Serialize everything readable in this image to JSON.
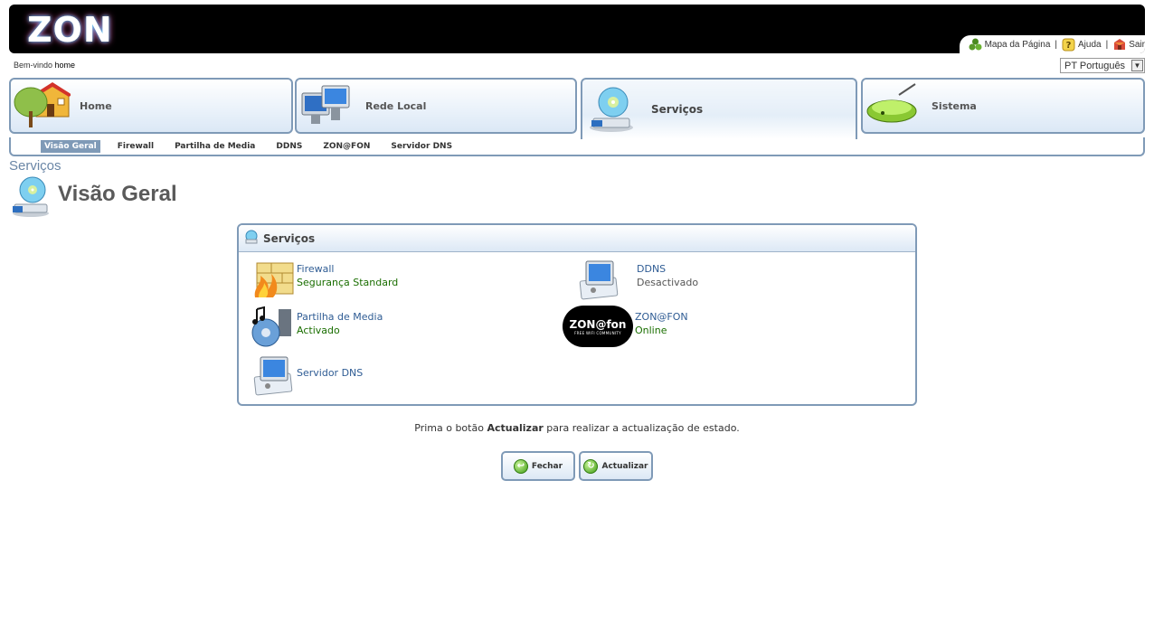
{
  "header": {
    "logo_text": "ZON",
    "links": [
      {
        "label": "Mapa da Página",
        "icon": "sitemap-icon"
      },
      {
        "label": "Ajuda",
        "icon": "help-icon"
      },
      {
        "label": "Sair",
        "icon": "exit-icon"
      }
    ],
    "separator": "|",
    "welcome_prefix": "Bem-vindo",
    "welcome_user": "home",
    "language": "PT Português"
  },
  "main_tabs": [
    {
      "label": "Home",
      "icon": "house-tree-icon"
    },
    {
      "label": "Rede Local",
      "icon": "computers-icon"
    },
    {
      "label": "Serviços",
      "icon": "disc-services-icon",
      "active": true
    },
    {
      "label": "Sistema",
      "icon": "router-icon"
    }
  ],
  "sub_tabs": [
    {
      "label": "Visão Geral",
      "active": true
    },
    {
      "label": "Firewall"
    },
    {
      "label": "Partilha de Media"
    },
    {
      "label": "DDNS"
    },
    {
      "label": "ZON@FON"
    },
    {
      "label": "Servidor DNS"
    }
  ],
  "breadcrumb": "Serviços",
  "page_title": "Visão Geral",
  "panel": {
    "title": "Serviços",
    "services": [
      {
        "name": "Firewall",
        "status": "Segurança Standard",
        "icon": "firewall-icon"
      },
      {
        "name": "DDNS",
        "status": "Desactivado",
        "icon": "ddns-icon"
      },
      {
        "name": "Partilha de Media",
        "status": "Activado",
        "icon": "media-share-icon"
      },
      {
        "name": "ZON@FON",
        "status": "Online",
        "icon": "zonfon-logo",
        "logo_text": "ZON@fon",
        "logo_sub": "FREE WIFI COMMUNITY"
      },
      {
        "name": "Servidor DNS",
        "status": "",
        "icon": "dns-server-icon"
      }
    ]
  },
  "message": {
    "before": "Prima o botão",
    "bold": "Actualizar",
    "after": "para realizar a actualização de estado."
  },
  "buttons": {
    "close_label": "Fechar",
    "refresh_label": "Actualizar"
  },
  "colors": {
    "border": "#7f9ab7",
    "link": "#2f5c94",
    "status_ok": "#1a6e00",
    "breadcrumb": "#6a86a6"
  }
}
